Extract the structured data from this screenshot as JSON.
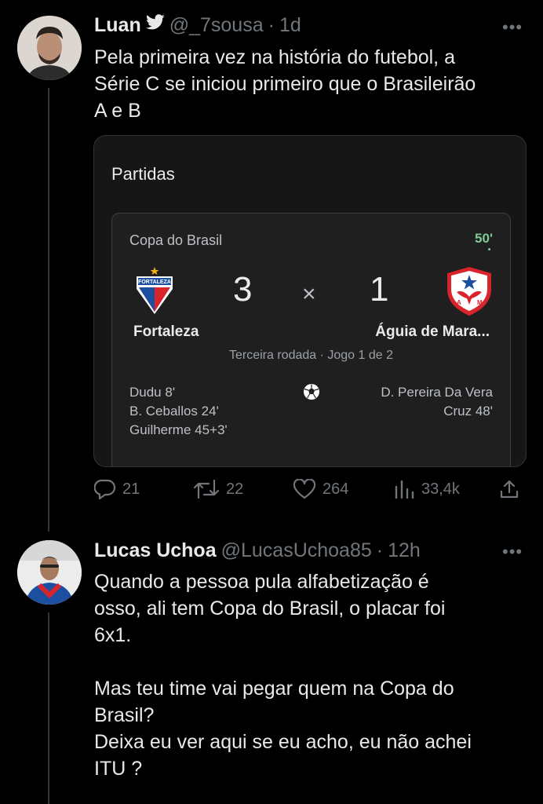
{
  "tweet1": {
    "name": "Luan",
    "handle": "@_7sousa",
    "sep": "·",
    "time": "1d",
    "text": "Pela primeira vez na história do futebol, a\nSérie C se iniciou primeiro que o Brasileirão\nA e B",
    "card": {
      "title": "Partidas",
      "competition": "Copa do Brasil",
      "minute": "50'",
      "home_team": "Fortaleza",
      "home_badge_text": "FORTALEZA",
      "home_score": "3",
      "separator": "×",
      "away_score": "1",
      "away_team": "Águia de Mara...",
      "round": "Terceira rodada · Jogo 1 de 2",
      "home_scorers": [
        "Dudu 8'",
        "B. Ceballos 24'",
        "Guilherme 45+3'"
      ],
      "away_scorers": [
        "D. Pereira Da Vera",
        "Cruz 48'"
      ]
    },
    "actions": {
      "replies": "21",
      "retweets": "22",
      "likes": "264",
      "views": "33,4k"
    }
  },
  "tweet2": {
    "name": "Lucas Uchoa",
    "handle": "@LucasUchoa85",
    "sep": "·",
    "time": "12h",
    "text": "Quando a pessoa pula alfabetização é\nosso, ali tem Copa do Brasil, o placar foi\n6x1.\n\nMas teu time vai pegar quem na Copa do\nBrasil?\nDeixa eu ver aqui se eu acho, eu não achei\nITU ?"
  },
  "more_glyph": "•••",
  "colors": {
    "background": "#000000",
    "text": "#e7e9ea",
    "muted": "#71767b",
    "live_green": "#81c995",
    "card_bg": "#161616"
  },
  "icons": [
    "verified-bird-icon",
    "reply-icon",
    "retweet-icon",
    "like-icon",
    "views-icon",
    "share-icon",
    "soccer-ball-icon"
  ]
}
